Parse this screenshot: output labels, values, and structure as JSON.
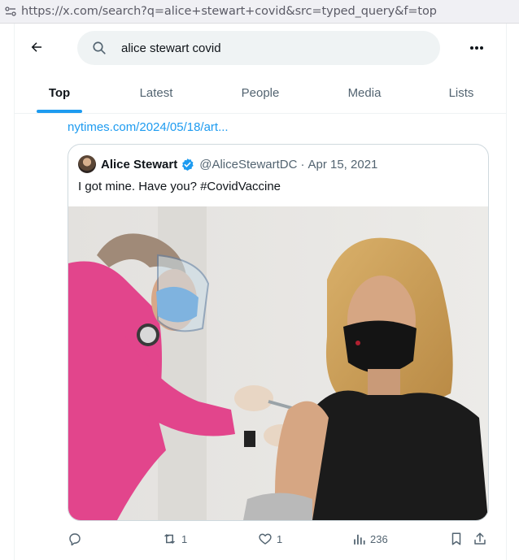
{
  "browser": {
    "url": "https://x.com/search?q=alice+stewart+covid&src=typed_query&f=top"
  },
  "header": {
    "search_value": "alice stewart covid",
    "back_icon": "arrow-left-icon",
    "more_icon": "more-horizontal-icon"
  },
  "tabs": [
    {
      "label": "Top",
      "active": true
    },
    {
      "label": "Latest",
      "active": false
    },
    {
      "label": "People",
      "active": false
    },
    {
      "label": "Media",
      "active": false
    },
    {
      "label": "Lists",
      "active": false
    }
  ],
  "tweet": {
    "link_text": "nytimes.com/2024/05/18/art..."
  },
  "quote": {
    "author_name": "Alice Stewart",
    "handle": "@AliceStewartDC",
    "separator": "·",
    "date": "Apr 15, 2021",
    "text": "I got mine. Have you? #CovidVaccine"
  },
  "actions": {
    "reply_count": "",
    "retweet_count": "1",
    "like_count": "1",
    "views_count": "236"
  },
  "colors": {
    "accent": "#1d9bf0",
    "text_primary": "#0f1419",
    "text_secondary": "#536471",
    "search_bg": "#eff3f4"
  }
}
